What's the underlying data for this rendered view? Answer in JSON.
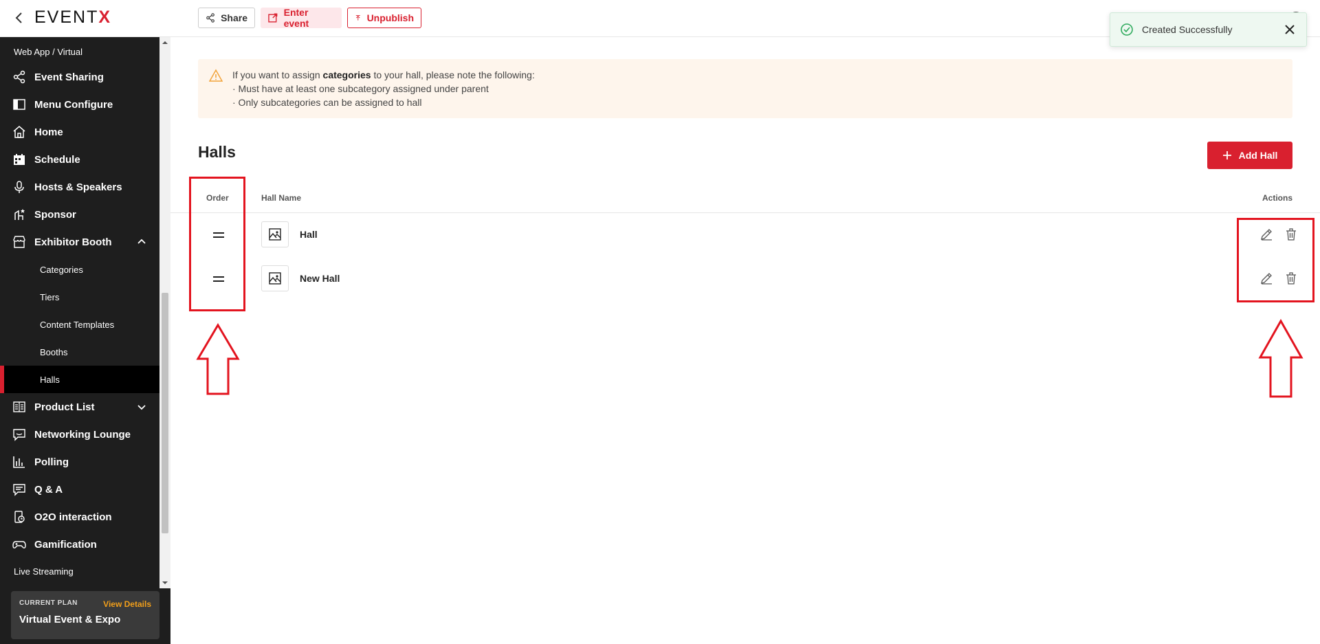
{
  "topbar": {
    "logo_main": "EVENT",
    "logo_x": "X",
    "share_label": "Share",
    "enter_label": "Enter event",
    "unpublish_label": "Unpublish"
  },
  "toast": {
    "text": "Created Successfully",
    "color": "#2eaa5c"
  },
  "sidebar": {
    "section_caption": "Web App / Virtual",
    "items": [
      {
        "label": "Event Sharing",
        "icon": "share-icon"
      },
      {
        "label": "Menu Configure",
        "icon": "layout-icon"
      },
      {
        "label": "Home",
        "icon": "home-icon"
      },
      {
        "label": "Schedule",
        "icon": "calendar-icon"
      },
      {
        "label": "Hosts & Speakers",
        "icon": "microphone-icon"
      },
      {
        "label": "Sponsor",
        "icon": "sponsor-icon"
      },
      {
        "label": "Exhibitor Booth",
        "icon": "store-icon"
      },
      {
        "label": "Product List",
        "icon": "book-icon"
      },
      {
        "label": "Networking Lounge",
        "icon": "chat-smile-icon"
      },
      {
        "label": "Polling",
        "icon": "bar-chart-icon"
      },
      {
        "label": "Q & A",
        "icon": "message-icon"
      },
      {
        "label": "O2O interaction",
        "icon": "device-icon"
      },
      {
        "label": "Gamification",
        "icon": "gamepad-icon"
      }
    ],
    "sub_items": [
      "Categories",
      "Tiers",
      "Content Templates",
      "Booths",
      "Halls"
    ],
    "active_sub": "Halls",
    "live_streaming": "Live Streaming",
    "plan": {
      "label": "CURRENT PLAN",
      "link": "View Details",
      "name": "Virtual Event & Expo"
    }
  },
  "notice": {
    "prefix": "If you want to assign ",
    "bold": "categories",
    "suffix": " to your hall, please note the following:",
    "points": [
      "· Must have at least one subcategory assigned under parent",
      "· Only subcategories can be assigned to hall"
    ]
  },
  "halls": {
    "title": "Halls",
    "add_label": "Add Hall",
    "columns": {
      "order": "Order",
      "name": "Hall Name",
      "actions": "Actions"
    },
    "rows": [
      {
        "name": "Hall"
      },
      {
        "name": "New Hall"
      }
    ]
  },
  "colors": {
    "accent": "#d9202f",
    "sidebar_bg": "#1e1e1e",
    "notice_bg": "#fef5ec",
    "warning": "#f2a33a",
    "plan_link": "#f29f1a",
    "annotation": "#e3141f"
  }
}
